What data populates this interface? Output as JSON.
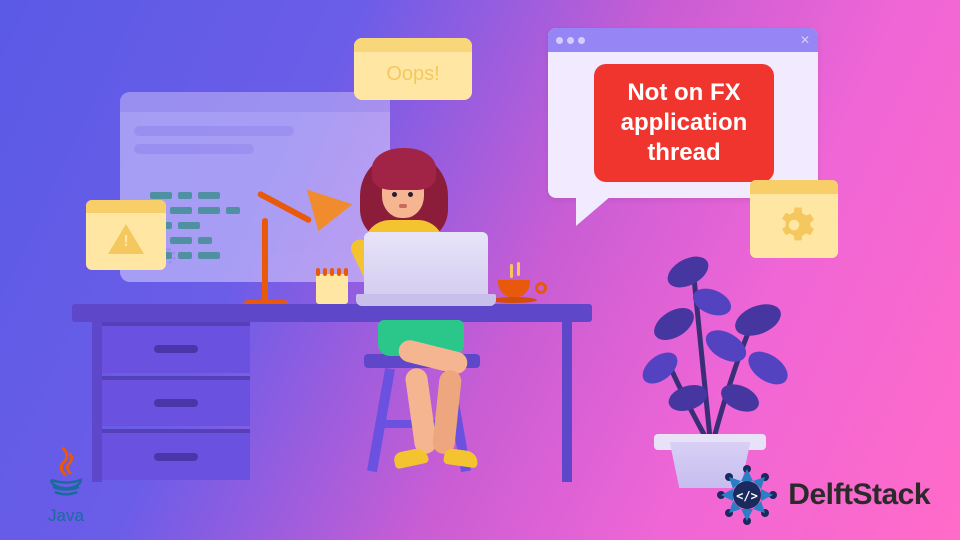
{
  "main_error": {
    "line1": "Not on FX",
    "line2": "application",
    "line3": "thread"
  },
  "oops_text": "Oops!",
  "branding": {
    "delftstack": "DelftStack",
    "java": "Java"
  },
  "colors": {
    "error_red": "#f0352f",
    "accent_purple": "#6b51e0",
    "accent_yellow": "#f4c430",
    "accent_orange": "#e8590c"
  }
}
